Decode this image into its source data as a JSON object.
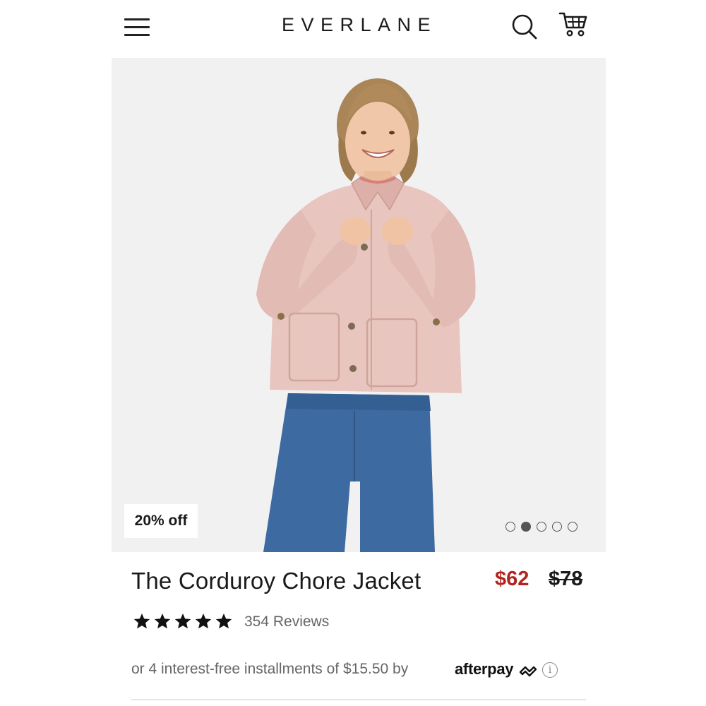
{
  "header": {
    "brand": "EVERLANE",
    "icons": {
      "menu": "hamburger-menu-icon",
      "search": "search-icon",
      "cart": "cart-icon"
    }
  },
  "hero": {
    "badge": "20% off",
    "carousel": {
      "count": 5,
      "active_index": 1
    }
  },
  "product": {
    "title": "The Corduroy Chore Jacket",
    "price_sale": "$62",
    "price_original": "$78",
    "rating": {
      "stars": 5,
      "label": "354 Reviews"
    },
    "installments": {
      "text": "or 4 interest-free installments of $15.50 by",
      "provider": "afterpay",
      "info_icon": "info-icon"
    }
  },
  "colors": {
    "sale_price": "#b3241e",
    "text": "#1a1a1a",
    "muted": "#666666",
    "hero_bg": "#f1f1f2",
    "jacket": "#e8c6bf",
    "denim": "#3d6aa1"
  }
}
